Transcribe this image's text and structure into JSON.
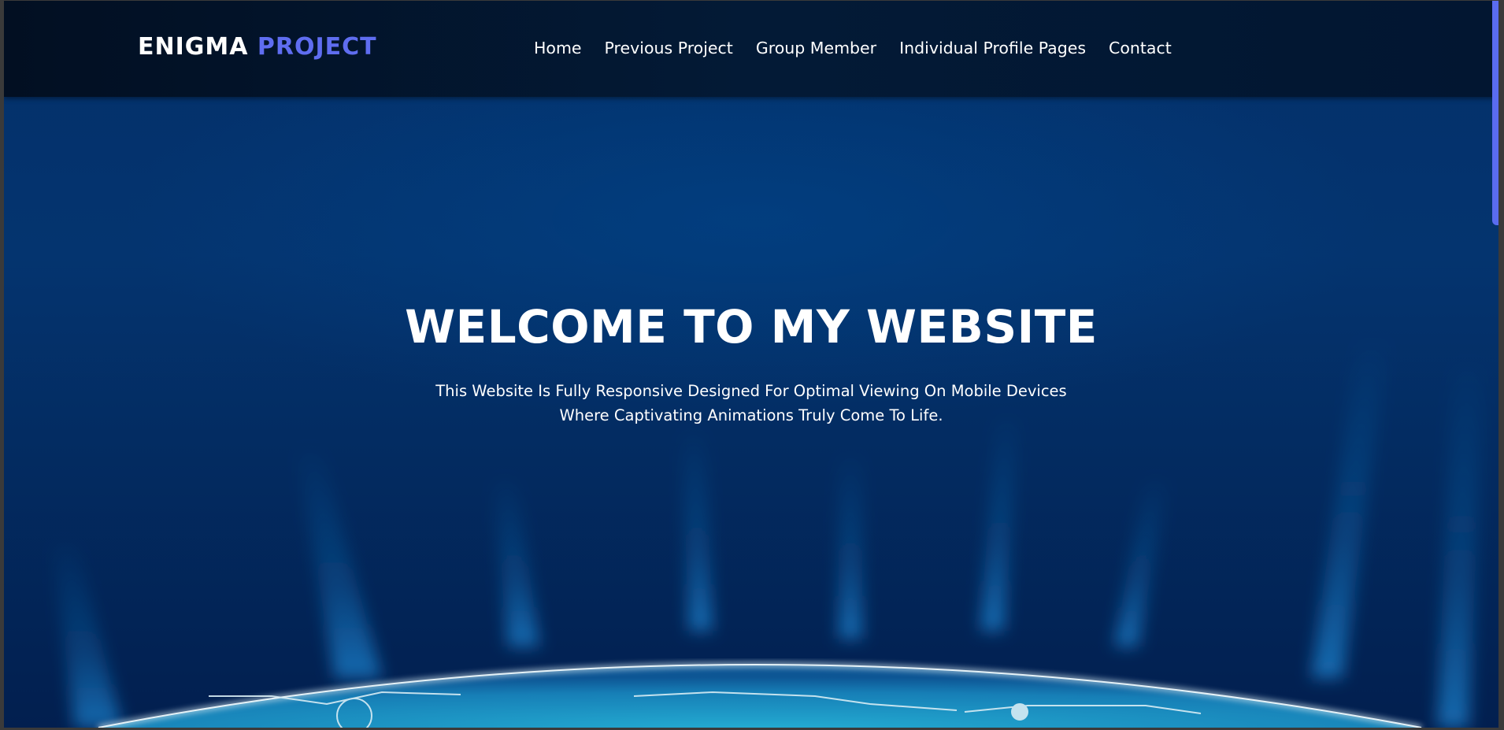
{
  "brand": {
    "part1": "ENIGMA",
    "part2": "PROJECT",
    "accent_color": "#5f6df0"
  },
  "nav": {
    "items": [
      {
        "label": "Home"
      },
      {
        "label": "Previous Project"
      },
      {
        "label": "Group Member"
      },
      {
        "label": "Individual Profile Pages"
      },
      {
        "label": "Contact"
      }
    ]
  },
  "hero": {
    "title": "WELCOME TO MY WEBSITE",
    "subtitle_line1": "This Website Is Fully Responsive Designed For Optimal Viewing On Mobile Devices",
    "subtitle_line2": "Where Captivating Animations Truly Come To Life."
  },
  "colors": {
    "navbar": "#031a36",
    "hero_background": "#04346f",
    "scrollbar_thumb": "#5a6cf0"
  }
}
